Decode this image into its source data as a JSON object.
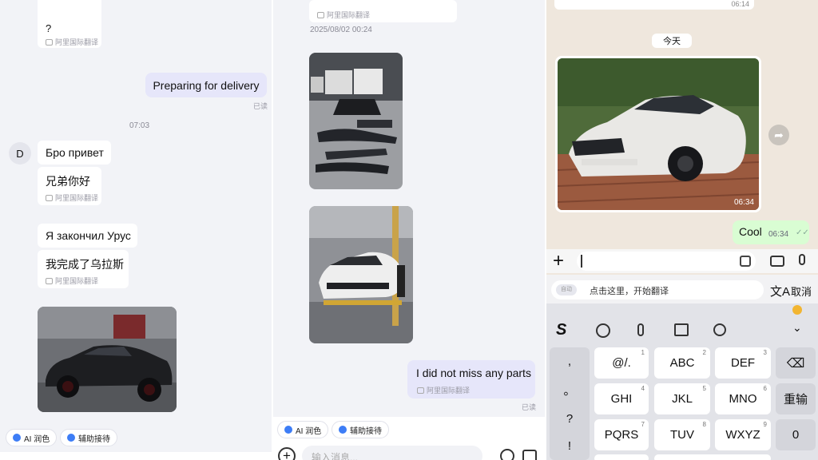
{
  "panel1": {
    "q_bubble": "?",
    "translate_tag": "阿里国际翻译",
    "out_msg": "Preparing for delivery",
    "read_status": "已读",
    "time_0703": "07:03",
    "avatar_letter": "D",
    "msg_ru1": "Бро привет",
    "msg_cn1": "兄弟你好",
    "msg_ru2": "Я закончил Урус",
    "msg_cn2": "我完成了乌拉斯",
    "chip_ai": "AI 润色",
    "chip_assist": "辅助接待"
  },
  "panel2": {
    "translate_tag": "阿里国际翻译",
    "date": "2025/08/02 00:24",
    "out_msg": "I did not miss any parts",
    "read_status": "已读",
    "chip_ai": "AI 润色",
    "chip_assist": "辅助接待",
    "input_placeholder": "输入消息..."
  },
  "panel3": {
    "top_time": "06:14",
    "date_pill": "今天",
    "photo_time": "06:34",
    "out_msg": "Cool",
    "out_time": "06:34",
    "translate_mode": "自动",
    "translate_hint": "点击这里，开始翻译",
    "cancel": "取消"
  },
  "keyboard": {
    "left_col": [
      ",",
      "。",
      "?",
      "!"
    ],
    "keys": [
      {
        "label": "@/.",
        "num": "1"
      },
      {
        "label": "ABC",
        "num": "2"
      },
      {
        "label": "DEF",
        "num": "3"
      },
      {
        "label": "GHI",
        "num": "4"
      },
      {
        "label": "JKL",
        "num": "5"
      },
      {
        "label": "MNO",
        "num": "6"
      },
      {
        "label": "PQRS",
        "num": "7"
      },
      {
        "label": "TUV",
        "num": "8"
      },
      {
        "label": "WXYZ",
        "num": "9"
      }
    ],
    "reenter": "重输",
    "zero": "0"
  },
  "colors": {
    "accent_blue": "#3d7df6",
    "whatsapp_green": "#d9fdd3",
    "purple_bubble": "#e6e6fa"
  }
}
